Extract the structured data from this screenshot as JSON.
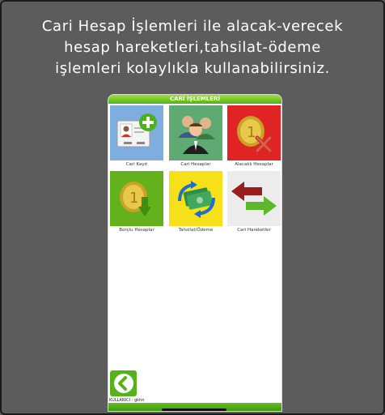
{
  "headline": {
    "line1": "Cari Hesap İşlemleri ile alacak-verecek",
    "line2": "hesap hareketleri,tahsilat-ödeme",
    "line3": "işlemleri kolaylıkla kullanabilirsiniz."
  },
  "app": {
    "title": "CARİ İŞLEMLERİ",
    "tiles": [
      {
        "label": "Cari Kayıt",
        "color": "#7eaee0",
        "icon": "user-card-add-icon"
      },
      {
        "label": "Cari Hesaplar",
        "color": "#5faa73",
        "icon": "people-group-icon"
      },
      {
        "label": "Alacaklı Hesaplar",
        "color": "#e02424",
        "icon": "coins-cross-icon"
      },
      {
        "label": "Borçlu Hesaplar",
        "color": "#63b21b",
        "icon": "coins-arrow-icon"
      },
      {
        "label": "Tahsilat/Ödeme",
        "color": "#f5e01a",
        "icon": "money-exchange-icon"
      },
      {
        "label": "Cari Hareketler",
        "color": "#ececec",
        "icon": "double-arrows-icon"
      }
    ],
    "footer": "KULLANICI : gkhn",
    "accent": "#55b21b"
  }
}
